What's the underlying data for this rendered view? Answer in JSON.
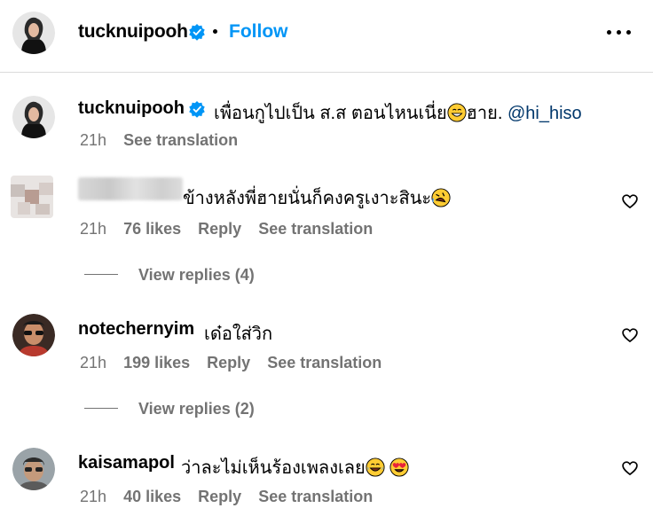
{
  "header": {
    "username": "tucknuipooh",
    "follow_label": "Follow"
  },
  "caption": {
    "username": "tucknuipooh",
    "text": "เพื่อนกูไปเป็น ส.ส ตอนไหนเนี่ย",
    "text_after_emoji": "ฮาย.",
    "mention": "@hi_hiso",
    "time": "21h",
    "see_translation": "See translation"
  },
  "comments": [
    {
      "username": "",
      "text": "ข้างหลังพี่ฮายนั่นก็คงครูเงาะสินะ",
      "time": "21h",
      "likes": "76 likes",
      "reply": "Reply",
      "see_translation": "See translation",
      "view_replies": "View replies (4)"
    },
    {
      "username": "notechernyim",
      "text": "เด๋อใส่วิก",
      "time": "21h",
      "likes": "199 likes",
      "reply": "Reply",
      "see_translation": "See translation",
      "view_replies": "View replies (2)"
    },
    {
      "username": "kaisamapol",
      "text": "ว่าละไม่เห็นร้องเพลงเลย",
      "time": "21h",
      "likes": "40 likes",
      "reply": "Reply",
      "see_translation": "See translation"
    }
  ],
  "icons": {
    "verified": "verified-badge-icon",
    "more": "more-options-icon",
    "like": "heart-outline-icon"
  },
  "colors": {
    "link_blue": "#0095f6",
    "mention_blue": "#00376b",
    "secondary_text": "#737373",
    "divider": "#dbdbdb"
  }
}
